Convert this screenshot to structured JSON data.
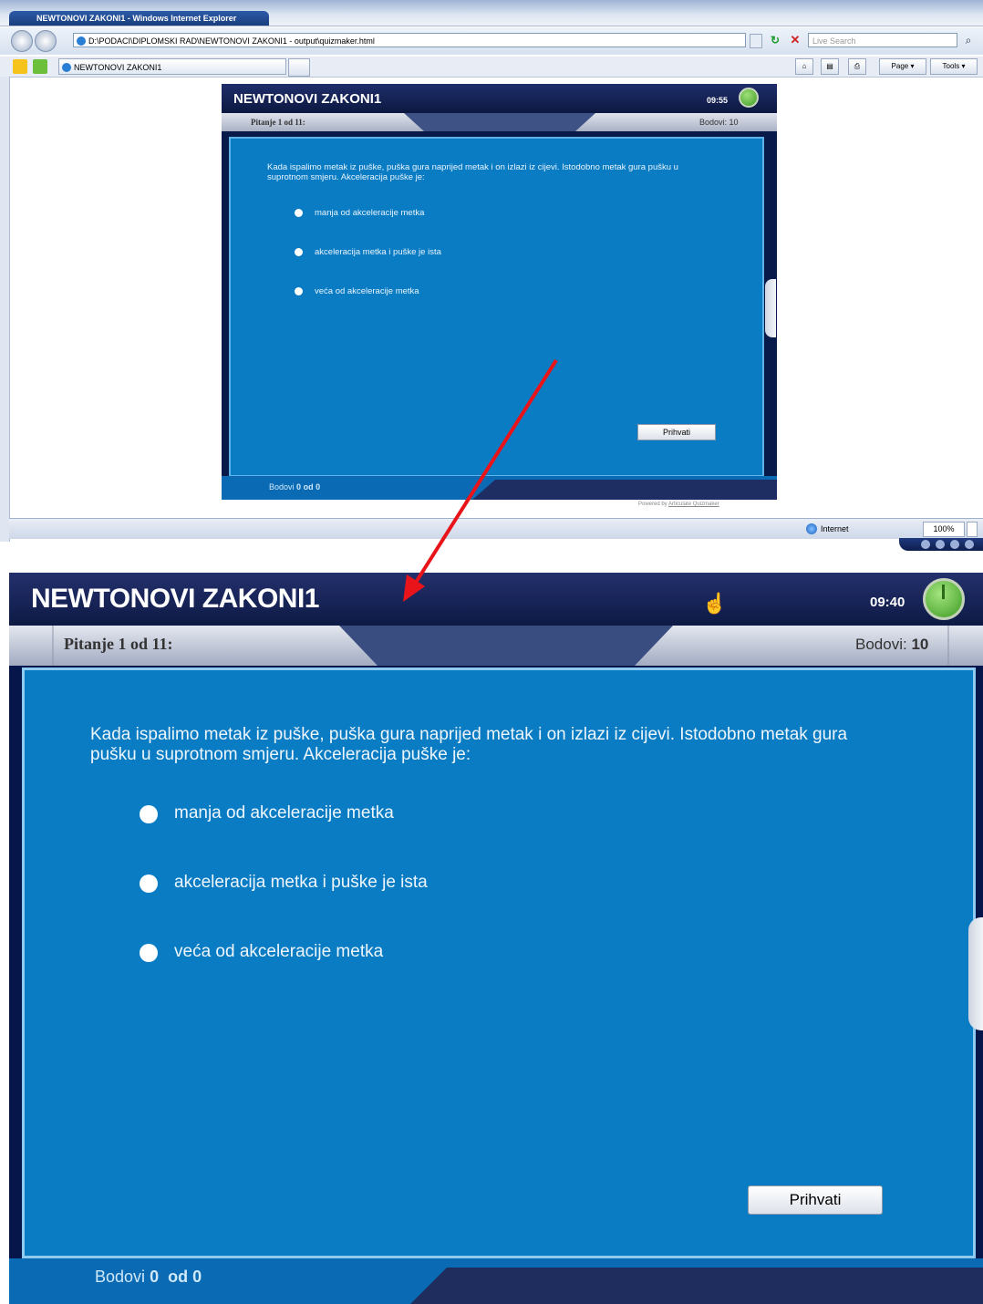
{
  "browser": {
    "window_title": "NEWTONOVI ZAKONI1 - Windows Internet Explorer",
    "address": "D:\\PODACI\\DIPLOMSKI RAD\\NEWTONOVI ZAKONI1 - output\\quizmaker.html",
    "search_placeholder": "Live Search",
    "tab_label": "NEWTONOVI ZAKONI1",
    "toolbar": {
      "page_label": "Page",
      "tools_label": "Tools"
    },
    "status_zone": "Internet",
    "zoom": "100%",
    "powered_by": "Powered by",
    "powered_link": "Articulate Quizmaker"
  },
  "quiz_small": {
    "title": "NEWTONOVI ZAKONI1",
    "timer": "09:55",
    "question_counter": "Pitanje 1 od 11:",
    "points_label": "Bodovi: 10",
    "question": "Kada ispalimo metak iz puške, puška gura naprijed metak i on izlazi iz cijevi. Istodobno metak gura pušku u suprotnom smjeru. Akceleracija puške je:",
    "options": [
      "manja od akceleracije metka",
      "akceleracija metka i puške je ista",
      "veća od akceleracije metka"
    ],
    "submit_label": "Prihvati",
    "score_label": "Bodovi",
    "score_value": "0",
    "score_of": "od 0"
  },
  "quiz_large": {
    "title": "NEWTONOVI ZAKONI1",
    "timer": "09:40",
    "question_counter": "Pitanje 1 od 11:",
    "points_label": "Bodovi:",
    "points_value": "10",
    "question": "Kada ispalimo metak iz puške, puška gura naprijed metak i on izlazi iz cijevi. Istodobno metak gura pušku u suprotnom smjeru. Akceleracija puške je:",
    "options": [
      "manja od akceleracije metka",
      "akceleracija metka i puške je ista",
      "veća od akceleracije metka"
    ],
    "submit_label": "Prihvati",
    "score_label": "Bodovi",
    "score_value": "0",
    "score_of": "od 0"
  },
  "colors": {
    "quiz_blue": "#0a7cc4",
    "header_navy": "#0d1a45",
    "timer_green": "#4caf32",
    "arrow_red": "#e8141a"
  }
}
